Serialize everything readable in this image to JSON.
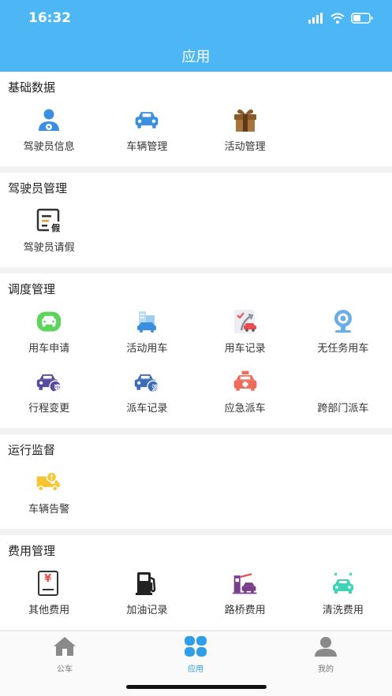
{
  "status_bar": {
    "time": "16:32"
  },
  "header": {
    "title": "应用"
  },
  "sections": [
    {
      "title": "基础数据",
      "items": [
        {
          "label": "驾驶员信息",
          "icon": "driver-icon"
        },
        {
          "label": "车辆管理",
          "icon": "car-icon"
        },
        {
          "label": "活动管理",
          "icon": "gift-icon"
        }
      ]
    },
    {
      "title": "驾驶员管理",
      "items": [
        {
          "label": "驾驶员请假",
          "icon": "leave-request-icon",
          "badge": "假"
        }
      ]
    },
    {
      "title": "调度管理",
      "items": [
        {
          "label": "用车申请",
          "icon": "car-request-icon"
        },
        {
          "label": "活动用车",
          "icon": "activity-car-icon"
        },
        {
          "label": "用车记录",
          "icon": "car-record-icon"
        },
        {
          "label": "无任务用车",
          "icon": "no-task-car-icon"
        },
        {
          "label": "行程变更",
          "icon": "trip-change-icon",
          "badge": "变"
        },
        {
          "label": "派车记录",
          "icon": "dispatch-record-icon",
          "badge": "派"
        },
        {
          "label": "应急派车",
          "icon": "emergency-dispatch-icon"
        },
        {
          "label": "跨部门派车",
          "icon": "cross-department-icon"
        }
      ]
    },
    {
      "title": "运行监督",
      "items": [
        {
          "label": "车辆告警",
          "icon": "vehicle-alarm-icon"
        }
      ]
    },
    {
      "title": "费用管理",
      "items": [
        {
          "label": "其他费用",
          "icon": "other-fee-icon",
          "badge": "¥"
        },
        {
          "label": "加油记录",
          "icon": "fuel-icon"
        },
        {
          "label": "路桥费用",
          "icon": "toll-fee-icon"
        },
        {
          "label": "清洗费用",
          "icon": "car-wash-icon"
        }
      ]
    }
  ],
  "tabbar": {
    "tabs": [
      {
        "label": "公车",
        "icon": "home-icon",
        "active": false
      },
      {
        "label": "应用",
        "icon": "apps-icon",
        "active": true
      },
      {
        "label": "我的",
        "icon": "profile-icon",
        "active": false
      }
    ]
  },
  "colors": {
    "header": "#4db6f5",
    "active_tab": "#2f9ee8",
    "inactive_tab": "#777777"
  }
}
